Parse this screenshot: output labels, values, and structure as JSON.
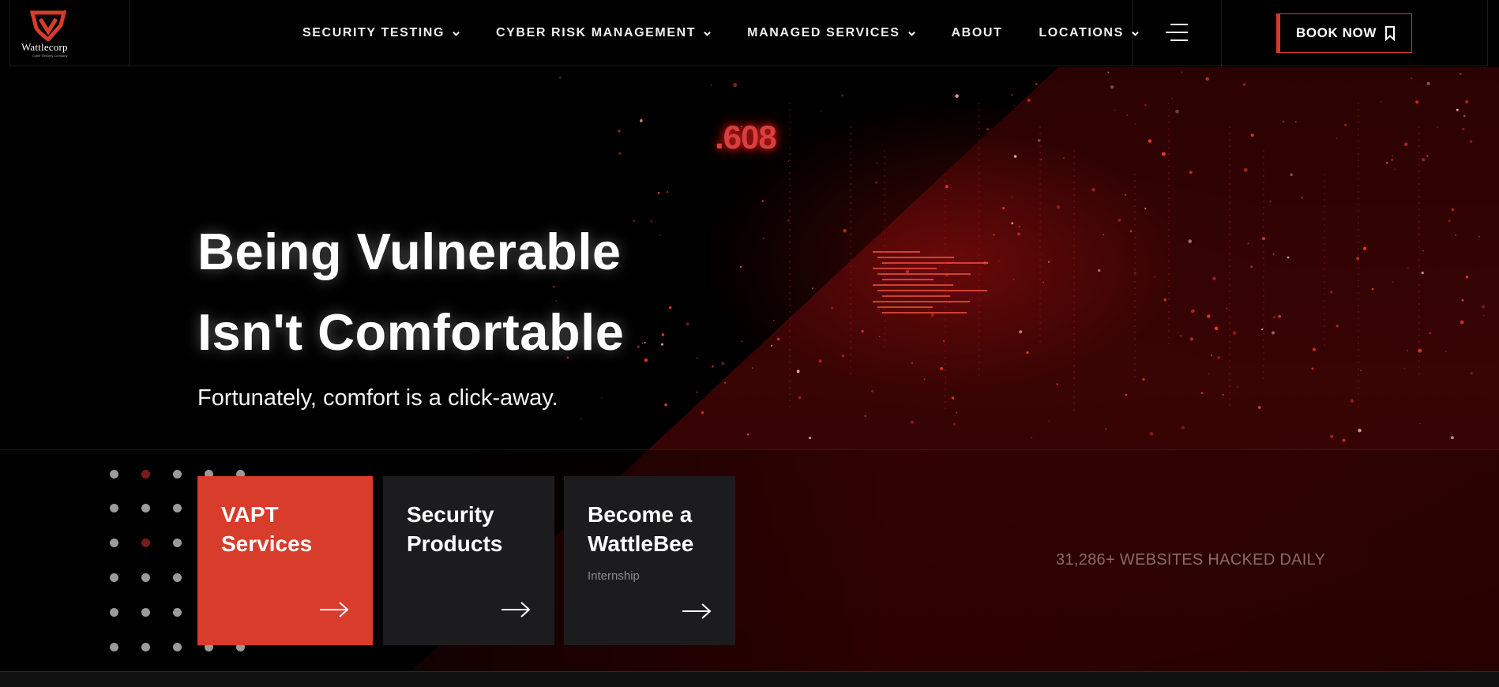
{
  "brand": {
    "name": "Wattlecorp",
    "tagline": "Cyber Security Company",
    "accent_color": "#d83c2a"
  },
  "nav": {
    "items": [
      {
        "label": "SECURITY TESTING",
        "has_dropdown": true
      },
      {
        "label": "CYBER RISK MANAGEMENT",
        "has_dropdown": true
      },
      {
        "label": "MANAGED SERVICES",
        "has_dropdown": true
      },
      {
        "label": "ABOUT",
        "has_dropdown": false
      },
      {
        "label": "LOCATIONS",
        "has_dropdown": true
      }
    ],
    "menu_icon": "hamburger-icon",
    "cta_label": "BOOK NOW",
    "cta_icon": "bookmark-icon"
  },
  "hero": {
    "title_line1": "Being Vulnerable",
    "title_line2": "Isn't Comfortable",
    "subtitle": "Fortunately, comfort is a click-away.",
    "glitch_text": ".608"
  },
  "cards": [
    {
      "title_line1": "VAPT",
      "title_line2": "Services",
      "subtitle": "",
      "color": "#d83c2a",
      "icon": "arrow-right-icon"
    },
    {
      "title_line1": "Security",
      "title_line2": "Products",
      "subtitle": "",
      "color": "#1c1c1e",
      "icon": "arrow-right-icon"
    },
    {
      "title_line1": "Become a",
      "title_line2": "WattleBee",
      "subtitle": "Internship",
      "color": "#1c1c1e",
      "icon": "arrow-right-icon"
    }
  ],
  "stat": {
    "text": "31,286+ WEBSITES HACKED DAILY"
  }
}
